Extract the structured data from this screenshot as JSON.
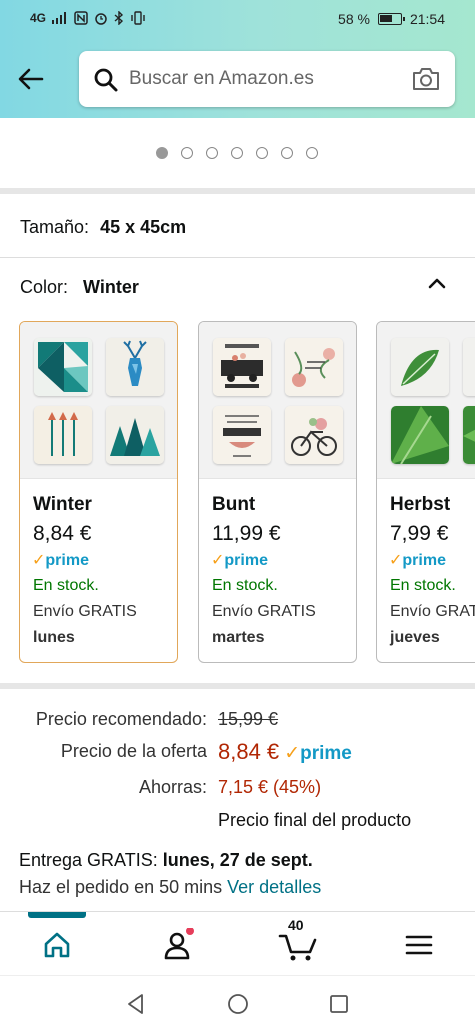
{
  "status_bar": {
    "network": "4G",
    "battery": "58 %",
    "time": "21:54"
  },
  "header": {
    "back_icon": "arrow-left-icon",
    "search_placeholder": "Buscar en Amazon.es",
    "search_icon": "search-icon",
    "camera_icon": "camera-icon"
  },
  "carousel": {
    "dot_count": 7,
    "active_index": 0
  },
  "size": {
    "label": "Tamaño:",
    "value": "45 x 45cm"
  },
  "color": {
    "label": "Color:",
    "value": "Winter"
  },
  "swatches": [
    {
      "name": "Winter",
      "price": "8,84 €",
      "prime": "prime",
      "stock": "En stock.",
      "shipping": "Envío GRATIS",
      "day": "lunes",
      "selected": true
    },
    {
      "name": "Bunt",
      "price": "11,99 €",
      "prime": "prime",
      "stock": "En stock.",
      "shipping": "Envío GRATIS",
      "day": "martes",
      "selected": false
    },
    {
      "name": "Herbst",
      "price": "7,99 €",
      "prime": "prime",
      "stock": "En stock.",
      "shipping": "Envío GRATIS",
      "day": "jueves",
      "selected": false
    }
  ],
  "pricing": {
    "recommended_label": "Precio recomendado:",
    "recommended_value": "15,99 €",
    "offer_label": "Precio de la oferta",
    "offer_value": "8,84 €",
    "prime": "prime",
    "savings_label": "Ahorras:",
    "savings_value": "7,15 € (45%)",
    "final_note": "Precio final del producto"
  },
  "delivery": {
    "label": "Entrega GRATIS:",
    "date": "lunes, 27 de sept.",
    "order_text": "Haz el pedido en 50 mins",
    "details_link": "Ver detalles"
  },
  "bottom_nav": {
    "items": [
      "home-icon",
      "account-icon",
      "cart-icon",
      "menu-icon"
    ],
    "cart_count": "40"
  },
  "colors": {
    "teal_link": "#007185",
    "price_red": "#b12704",
    "stock_green": "#007600",
    "prime_blue": "#1399c6",
    "selected_border": "#e1a75a"
  }
}
